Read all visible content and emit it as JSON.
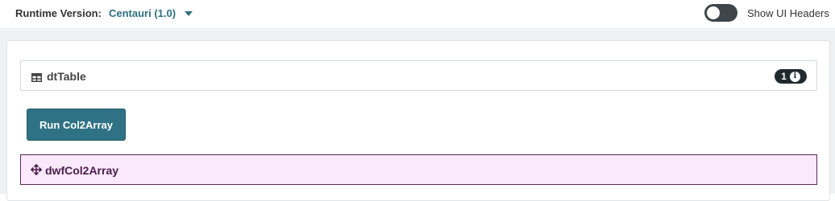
{
  "header": {
    "runtime_label": "Runtime Version:",
    "runtime_value": "Centauri (1.0)",
    "toggle_label": "Show UI Headers",
    "toggle_on": false
  },
  "table_card": {
    "title": "dtTable",
    "badge_count": "1",
    "info_glyph": "i",
    "icon": "table-icon"
  },
  "run_button": {
    "label": "Run Col2Array",
    "color": "#2f7285"
  },
  "dwf_card": {
    "title": "dwfCol2Array",
    "icon": "move-icon",
    "background": "#fae8fb",
    "border": "#5b2a5c"
  }
}
